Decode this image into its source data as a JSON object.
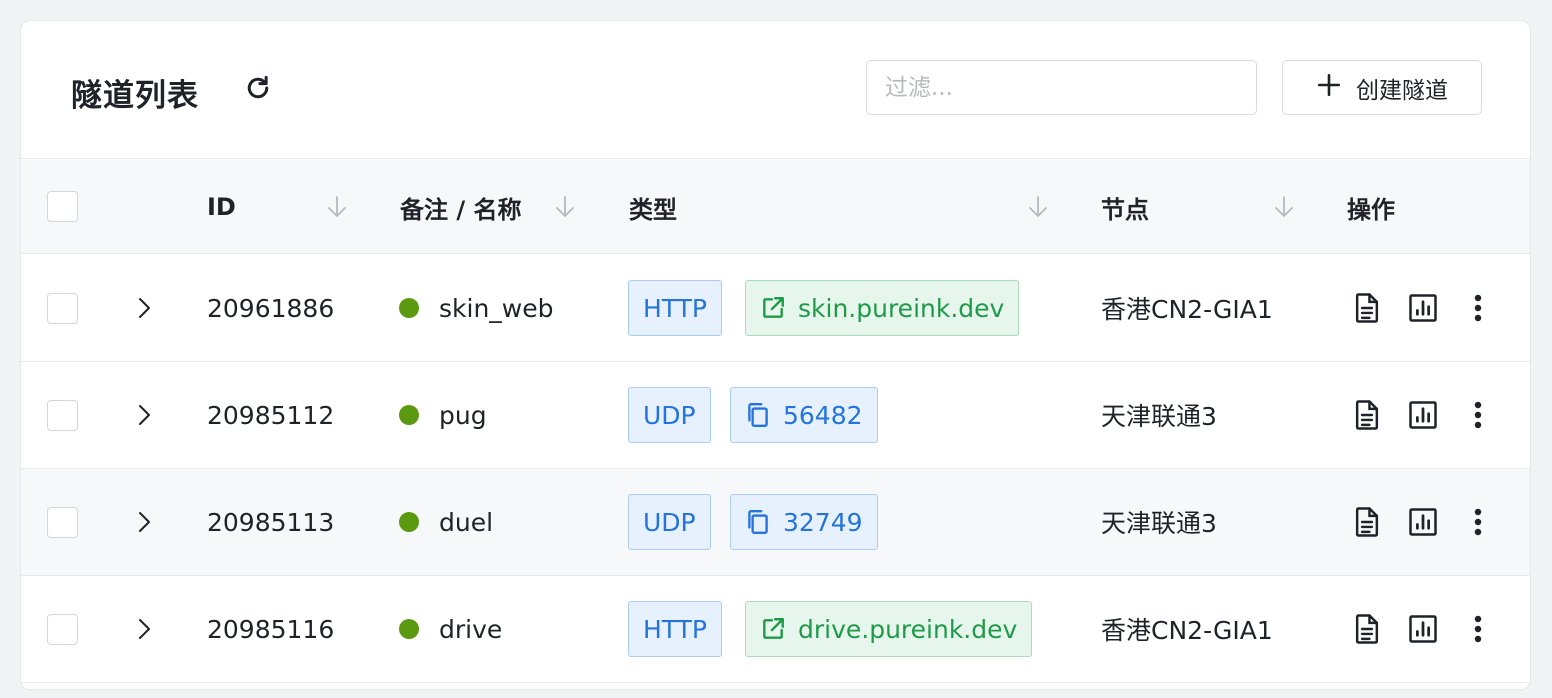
{
  "header": {
    "title": "隧道列表",
    "filter_placeholder": "过滤...",
    "create_label": "创建隧道"
  },
  "columns": {
    "id": "ID",
    "name": "备注 / 名称",
    "type": "类型",
    "node": "节点",
    "actions": "操作"
  },
  "rows": [
    {
      "id": "20961886",
      "name": "skin_web",
      "protocol": "HTTP",
      "endpoint": "skin.pureink.dev",
      "endpoint_kind": "link",
      "node": "香港CN2-GIA1"
    },
    {
      "id": "20985112",
      "name": "pug",
      "protocol": "UDP",
      "endpoint": "56482",
      "endpoint_kind": "copy",
      "node": "天津联通3"
    },
    {
      "id": "20985113",
      "name": "duel",
      "protocol": "UDP",
      "endpoint": "32749",
      "endpoint_kind": "copy",
      "node": "天津联通3"
    },
    {
      "id": "20985116",
      "name": "drive",
      "protocol": "HTTP",
      "endpoint": "drive.pureink.dev",
      "endpoint_kind": "link",
      "node": "香港CN2-GIA1"
    }
  ],
  "colors": {
    "status_online": "#5b9a10",
    "protocol_tag": "#2474db",
    "link_tag": "#1f9a49"
  }
}
